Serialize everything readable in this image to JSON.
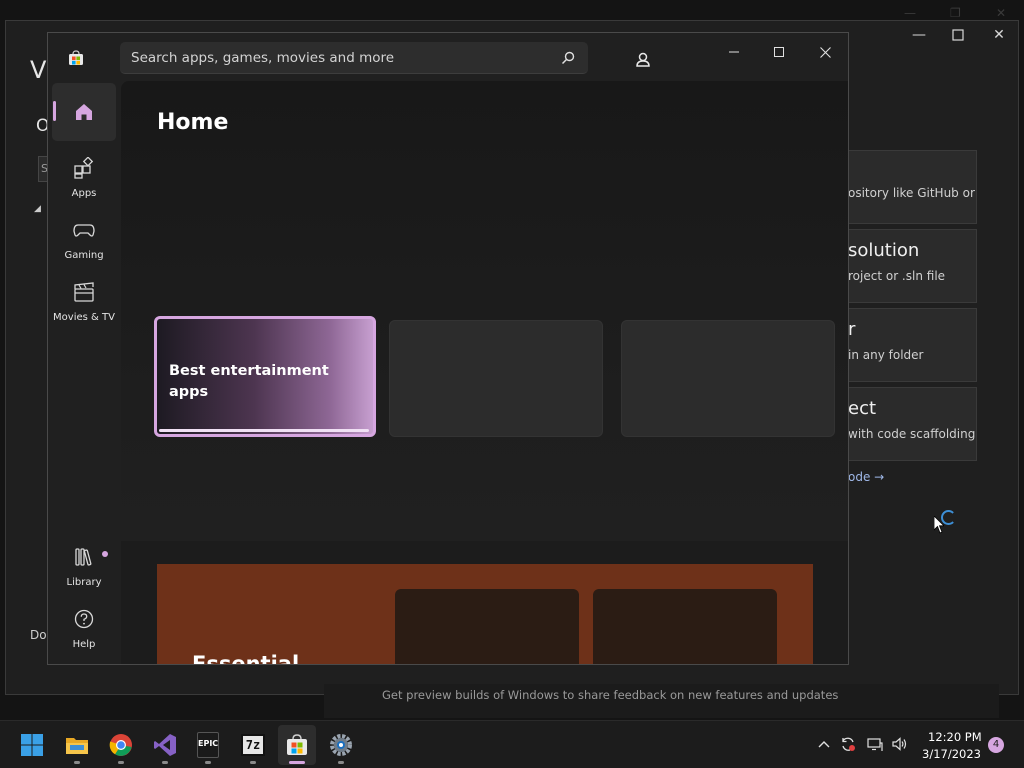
{
  "vs_window": {
    "title": "Vi",
    "subtitle": "O",
    "search_fragment": "S",
    "bottom_text": "Do",
    "cards": [
      {
        "title": "",
        "desc": "ository like GitHub or"
      },
      {
        "title": "solution",
        "desc": "roject or .sln file"
      },
      {
        "title": "r",
        "desc": "in any folder"
      },
      {
        "title": "ect",
        "desc": "with code scaffolding"
      }
    ],
    "link": "ode →",
    "preview_text": "Get preview builds of Windows to share feedback on new features and updates"
  },
  "store": {
    "search_placeholder": "Search apps, games, movies and more",
    "page_title": "Home",
    "nav": [
      {
        "id": "home",
        "label": "",
        "icon": "home-icon",
        "active": true
      },
      {
        "id": "apps",
        "label": "Apps",
        "icon": "apps-icon"
      },
      {
        "id": "gaming",
        "label": "Gaming",
        "icon": "gamepad-icon"
      },
      {
        "id": "movies",
        "label": "Movies & TV",
        "icon": "clapperboard-icon"
      },
      {
        "id": "library",
        "label": "Library",
        "icon": "library-icon",
        "badge": true
      },
      {
        "id": "help",
        "label": "Help",
        "icon": "help-icon"
      }
    ],
    "featured": [
      {
        "title": "Best entertainment apps",
        "selected": true
      },
      {
        "title": ""
      },
      {
        "title": ""
      }
    ],
    "section_title": "Essential",
    "accent": "#d6a6e0"
  },
  "taskbar": {
    "apps": [
      {
        "name": "start-button",
        "icon": "windows-logo-icon"
      },
      {
        "name": "file-explorer",
        "icon": "folder-icon"
      },
      {
        "name": "chrome",
        "icon": "chrome-icon"
      },
      {
        "name": "visual-studio",
        "icon": "visual-studio-icon"
      },
      {
        "name": "epic-games",
        "icon": "epic-games-icon",
        "text": "EPIC"
      },
      {
        "name": "7zip",
        "icon": "7zip-icon",
        "text": "7z"
      },
      {
        "name": "microsoft-store",
        "icon": "store-icon",
        "active": true
      },
      {
        "name": "settings",
        "icon": "settings-icon"
      }
    ],
    "time": "12:20 PM",
    "date": "3/17/2023",
    "notification_count": "4"
  }
}
